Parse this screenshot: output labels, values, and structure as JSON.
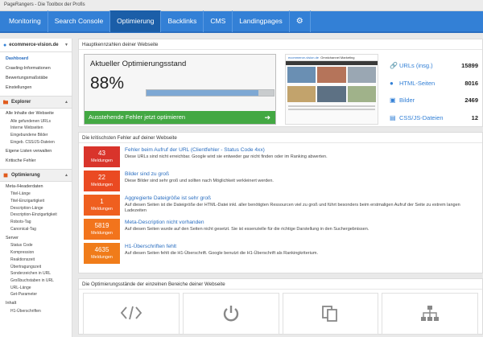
{
  "window_title": "PageRangers - Die Toolbox der Profis",
  "nav": {
    "items": [
      "Monitoring",
      "Search Console",
      "Optimierung",
      "Backlinks",
      "CMS",
      "Landingpages"
    ],
    "active": "Optimierung",
    "settings_icon": "gear-icon"
  },
  "sidebar": {
    "domain": "ecommerce-vision.de",
    "top_links": [
      "Dashboard",
      "Crawling-Informationen",
      "Bewertungsmaßstäbe",
      "Einstellungen"
    ],
    "explorer": {
      "title": "Explorer",
      "group1": "Alle Inhalte der Webseite",
      "sub1": [
        "Alle gefundenen URLs",
        "Interne Webseiten",
        "Eingebundene Bilder",
        "Eingeb. CSS/JS-Dateien"
      ],
      "group2": "Eigene Listen verwalten",
      "group3": "Kritische Fehler"
    },
    "optimierung": {
      "title": "Optimierung",
      "group1": "Meta-/Headerdaten",
      "sub1": [
        "Titel-Länge",
        "Titel-Einzigartigkeit",
        "Description-Länge",
        "Description-Einzigartigkeit",
        "Robots-Tag",
        "Canonical-Tag"
      ],
      "group2": "Server",
      "sub2": [
        "Status Code",
        "Kompression",
        "Reaktionszeit",
        "Übertragungszeit",
        "Sonderzeichen in URL",
        "Großbuchstaben in URL",
        "URL-Länge",
        "Get-Parameter"
      ],
      "group3": "Inhalt",
      "sub3": [
        "H1-Überschriften"
      ]
    }
  },
  "key_figures": {
    "title": "Hauptkennzahlen deiner Webseite",
    "opt_label": "Aktueller Optimierungsstand",
    "opt_percent": "88%",
    "opt_progress": 0.88,
    "opt_button": "Ausstehende Fehler jetzt optimieren",
    "thumb_site": "ecommerce-vision.de",
    "thumb_heading": "Omnichannel Marketing",
    "stats": [
      {
        "label": "URLs (insg.)",
        "value": "15899",
        "icon": "link-icon"
      },
      {
        "label": "HTML-Seiten",
        "value": "8016",
        "icon": "code-icon"
      },
      {
        "label": "Bilder",
        "value": "2469",
        "icon": "image-icon"
      },
      {
        "label": "CSS/JS-Dateien",
        "value": "12",
        "icon": "file-icon"
      }
    ]
  },
  "critical": {
    "title": "Die kritischsten Fehler auf deiner Webseite",
    "badge_label": "Meldungen",
    "errors": [
      {
        "count": "43",
        "color": "#d9342b",
        "title": "Fehler beim Aufruf der URL (Clientfehler - Status Code 4xx)",
        "desc": "Diese URLs sind nicht erreichbar. Google wird sie entweder gar nicht finden oder im Ranking abwerten."
      },
      {
        "count": "22",
        "color": "#ea4a22",
        "title": "Bilder sind zu groß",
        "desc": "Diese Bilder sind sehr groß und sollten nach Möglichkeit verkleinert werden."
      },
      {
        "count": "1",
        "color": "#ef5f1f",
        "title": "Aggregierte Dateigröße ist sehr groß",
        "desc": "Auf diesen Seiten ist die Dateigröße der HTML-Datei inkl. aller benötigten Ressourcen viel zu groß und führt besonders beim erstmaligen Aufruf der Seite zu extrem langen Ladezeiten"
      },
      {
        "count": "5819",
        "color": "#f2741c",
        "title": "Meta-Description nicht vorhanden",
        "desc": "Auf diesen Seiten wurde auf den Seiten nicht gesetzt. Sie ist essenzielle für die richtige Darstellung in den Suchergebnissen."
      },
      {
        "count": "4635",
        "color": "#f07c1a",
        "title": "H1-Überschriften fehlt",
        "desc": "Auf diesen Seiten fehlt die H1-Überschrift. Google benutzt die H1-Überschrift als Rankingkriterium."
      }
    ]
  },
  "areas": {
    "title": "Die Optimierungsstände der einzelnen Bereiche deiner Webseite",
    "tiles": [
      "code-icon",
      "power-icon",
      "copy-icon",
      "sitemap-icon"
    ]
  }
}
